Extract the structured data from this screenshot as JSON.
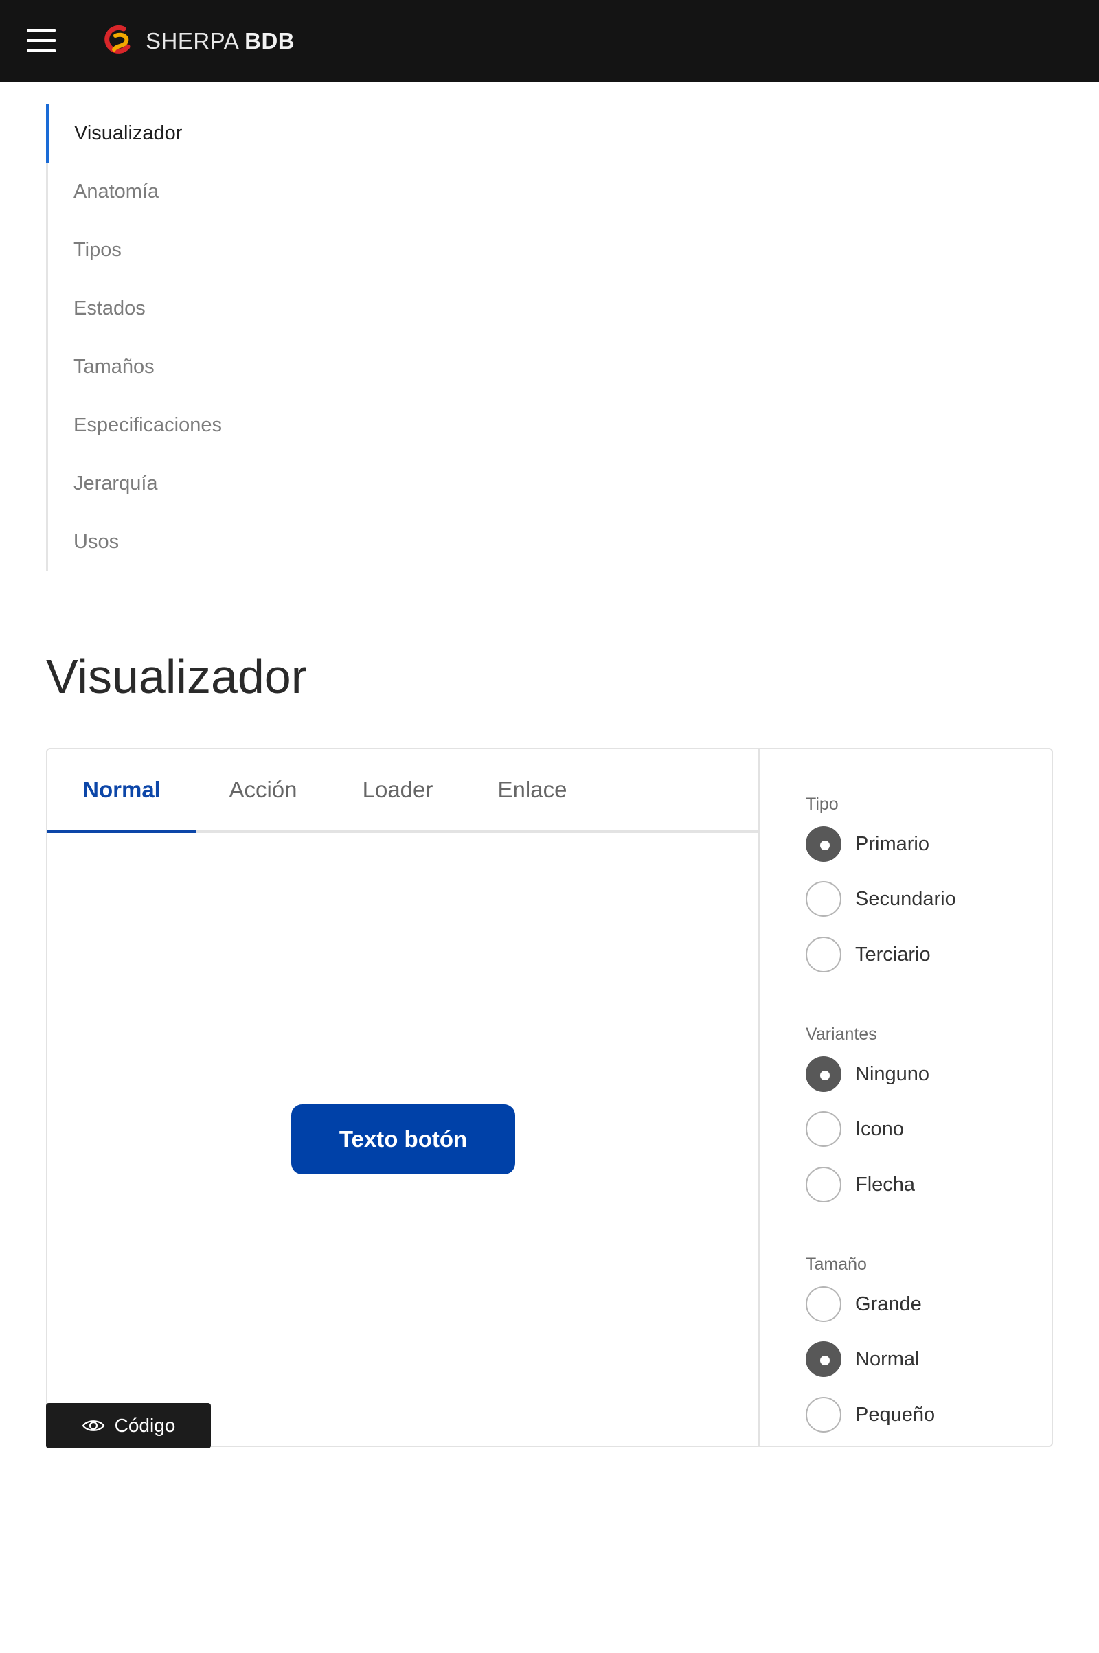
{
  "header": {
    "brand_light": "SHERPA",
    "brand_bold": "BDB"
  },
  "toc": {
    "items": [
      {
        "label": "Visualizador",
        "active": true
      },
      {
        "label": "Anatomía",
        "active": false
      },
      {
        "label": "Tipos",
        "active": false
      },
      {
        "label": "Estados",
        "active": false
      },
      {
        "label": "Tamaños",
        "active": false
      },
      {
        "label": "Especificaciones",
        "active": false
      },
      {
        "label": "Jerarquía",
        "active": false
      },
      {
        "label": "Usos",
        "active": false
      }
    ]
  },
  "section": {
    "title": "Visualizador"
  },
  "viewer": {
    "tabs": [
      {
        "label": "Normal",
        "active": true
      },
      {
        "label": "Acción",
        "active": false
      },
      {
        "label": "Loader",
        "active": false
      },
      {
        "label": "Enlace",
        "active": false
      }
    ],
    "preview_button_label": "Texto botón",
    "code_button_label": "Código",
    "code_button_icon": "eye-icon"
  },
  "controls": {
    "groups": [
      {
        "label": "Tipo",
        "options": [
          {
            "label": "Primario",
            "checked": true
          },
          {
            "label": "Secundario",
            "checked": false
          },
          {
            "label": "Terciario",
            "checked": false
          }
        ]
      },
      {
        "label": "Variantes",
        "options": [
          {
            "label": "Ninguno",
            "checked": true
          },
          {
            "label": "Icono",
            "checked": false
          },
          {
            "label": "Flecha",
            "checked": false
          }
        ]
      },
      {
        "label": "Tamaño",
        "options": [
          {
            "label": "Grande",
            "checked": false
          },
          {
            "label": "Normal",
            "checked": true
          },
          {
            "label": "Pequeño",
            "checked": false
          }
        ]
      }
    ]
  },
  "colors": {
    "topbar": "#141414",
    "accent": "#0041a8",
    "toc_active_bar": "#1a6bd6",
    "radio_checked": "#585858"
  }
}
